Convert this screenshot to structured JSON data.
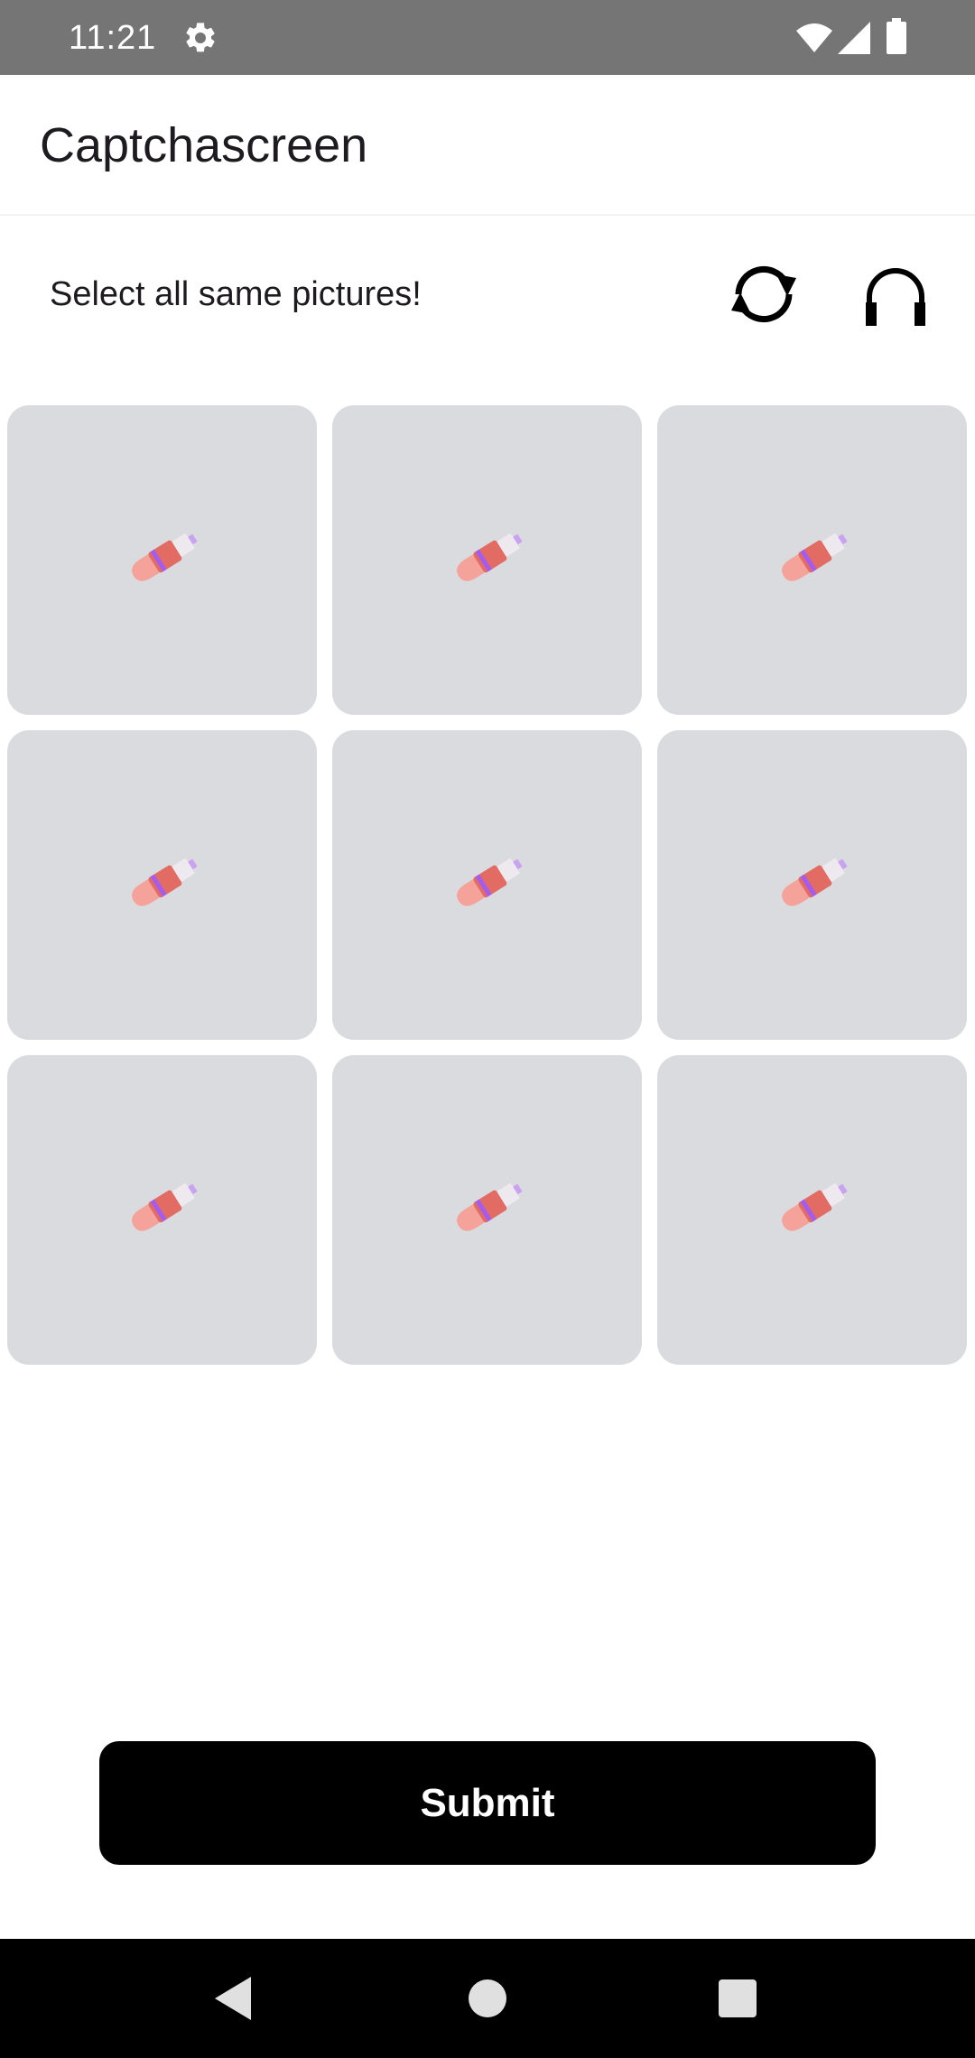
{
  "status_bar": {
    "time": "11:21",
    "icons": [
      "gear-icon",
      "wifi-icon",
      "cell-signal-icon",
      "battery-icon"
    ],
    "background": "#757575"
  },
  "app_bar": {
    "title": "Captchascreen"
  },
  "captcha": {
    "prompt": "Select all same pictures!",
    "refresh_icon": "refresh-icon",
    "audio_icon": "headphones-icon",
    "tiles": [
      {
        "icon": "lipstick-icon",
        "selected": false
      },
      {
        "icon": "lipstick-icon",
        "selected": false
      },
      {
        "icon": "lipstick-icon",
        "selected": false
      },
      {
        "icon": "lipstick-icon",
        "selected": false
      },
      {
        "icon": "lipstick-icon",
        "selected": false
      },
      {
        "icon": "lipstick-icon",
        "selected": false
      },
      {
        "icon": "lipstick-icon",
        "selected": false
      },
      {
        "icon": "lipstick-icon",
        "selected": false
      },
      {
        "icon": "lipstick-icon",
        "selected": false
      }
    ],
    "tile_color": "#dadbde"
  },
  "submit": {
    "label": "Submit",
    "color": "#000000"
  },
  "nav_bar": {
    "icons": [
      "back-icon",
      "home-icon",
      "recents-icon"
    ]
  }
}
